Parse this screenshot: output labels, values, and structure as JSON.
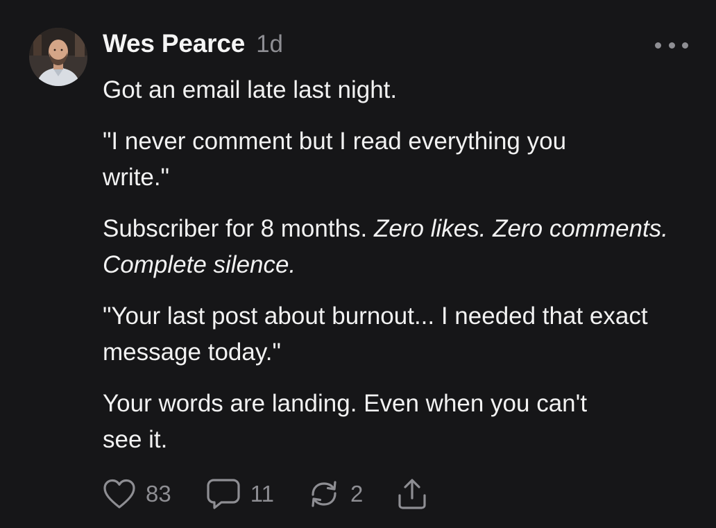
{
  "post": {
    "author": "Wes Pearce",
    "time": "1d",
    "paragraphs": {
      "p1": "Got an email late last night.",
      "p2": "\"I never comment but I read everything you write.\"",
      "p3_plain": "Subscriber for 8 months. ",
      "p3_italic": "Zero likes. Zero comments. Complete silence.",
      "p4": "\"Your last post about burnout... I needed that exact message today.\"",
      "p5": "Your words are landing. Even when you can't see it."
    },
    "actions": {
      "likes": "83",
      "comments": "11",
      "restacks": "2"
    }
  },
  "colors": {
    "background": "#161618",
    "text": "#f2f2f2",
    "muted": "#8e8e93"
  },
  "icons": {
    "more": "more-horizontal-icon",
    "like": "heart-icon",
    "comment": "speech-bubble-icon",
    "restack": "restack-arrows-icon",
    "share": "share-upload-icon"
  }
}
